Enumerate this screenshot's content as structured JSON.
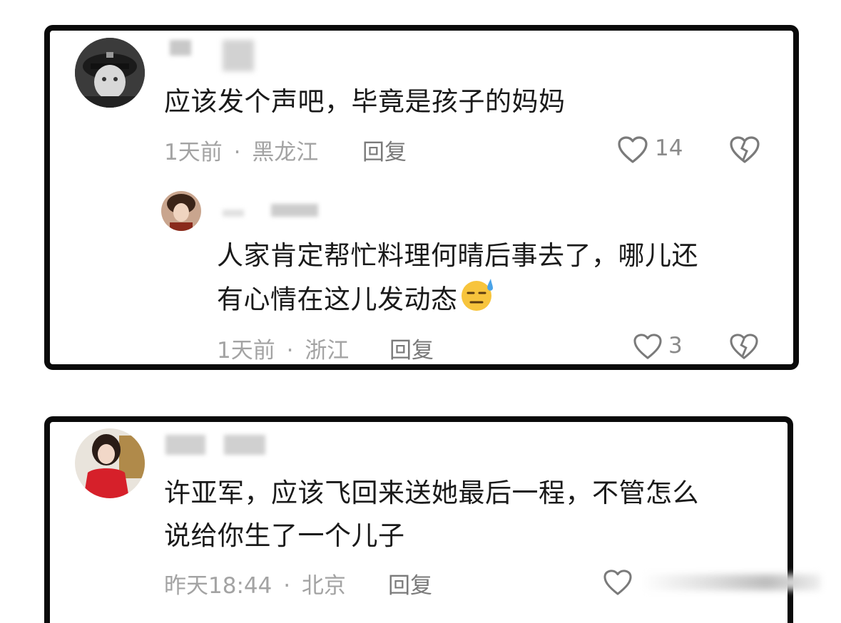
{
  "comments": [
    {
      "text": "应该发个声吧，毕竟是孩子的妈妈",
      "time": "1天前",
      "location": "黑龙江",
      "reply_label": "回复",
      "likes": "14",
      "reply": {
        "text_line1": "人家肯定帮忙料理何晴后事去了，哪儿还",
        "text_line2": "有心情在这儿发动态",
        "emoji": "sweat-smile-emoji",
        "time": "1天前",
        "location": "浙江",
        "reply_label": "回复",
        "likes": "3"
      }
    },
    {
      "text_line1": "许亚军，应该飞回来送她最后一程，不管怎么",
      "text_line2": "说给你生了一个儿子",
      "time": "昨天18:44",
      "location": "北京",
      "reply_label": "回复"
    }
  ],
  "meta_separator": "·",
  "icons": {
    "like": "heart-outline-icon",
    "dislike": "broken-heart-icon"
  },
  "colors": {
    "border": "#0a0a0a",
    "meta": "#a3a3a3",
    "text": "#1a1a1a"
  }
}
